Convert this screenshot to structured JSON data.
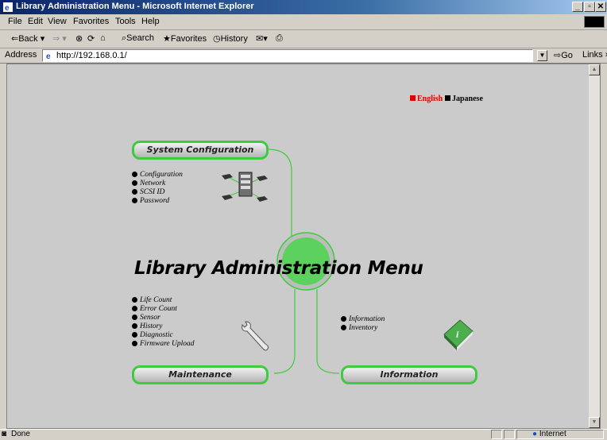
{
  "window": {
    "title": "Library Administration Menu - Microsoft Internet Explorer"
  },
  "menu": [
    "File",
    "Edit",
    "View",
    "Favorites",
    "Tools",
    "Help"
  ],
  "toolbar": {
    "back": "Back",
    "search": "Search",
    "favorites": "Favorites",
    "history": "History"
  },
  "address": {
    "label": "Address",
    "url": "http://192.168.0.1/",
    "go": "Go",
    "links": "Links"
  },
  "page": {
    "languages": [
      {
        "label": "English",
        "color": "#e00000"
      },
      {
        "label": "Japanese",
        "color": "#000000"
      }
    ],
    "title": "Library Administration Menu",
    "sections": {
      "system": {
        "label": "System Configuration",
        "items": [
          "Configuration",
          "Network",
          "SCSI ID",
          "Password"
        ]
      },
      "maintenance": {
        "label": "Maintenance",
        "items": [
          "Life Count",
          "Error Count",
          "Sensor",
          "History",
          "Diagnostic",
          "Firmware Upload"
        ]
      },
      "information": {
        "label": "Information",
        "items": [
          "Information",
          "Inventory"
        ]
      }
    },
    "accent_color": "#3fcb3f"
  },
  "status": {
    "text": "Done",
    "zone": "Internet"
  }
}
